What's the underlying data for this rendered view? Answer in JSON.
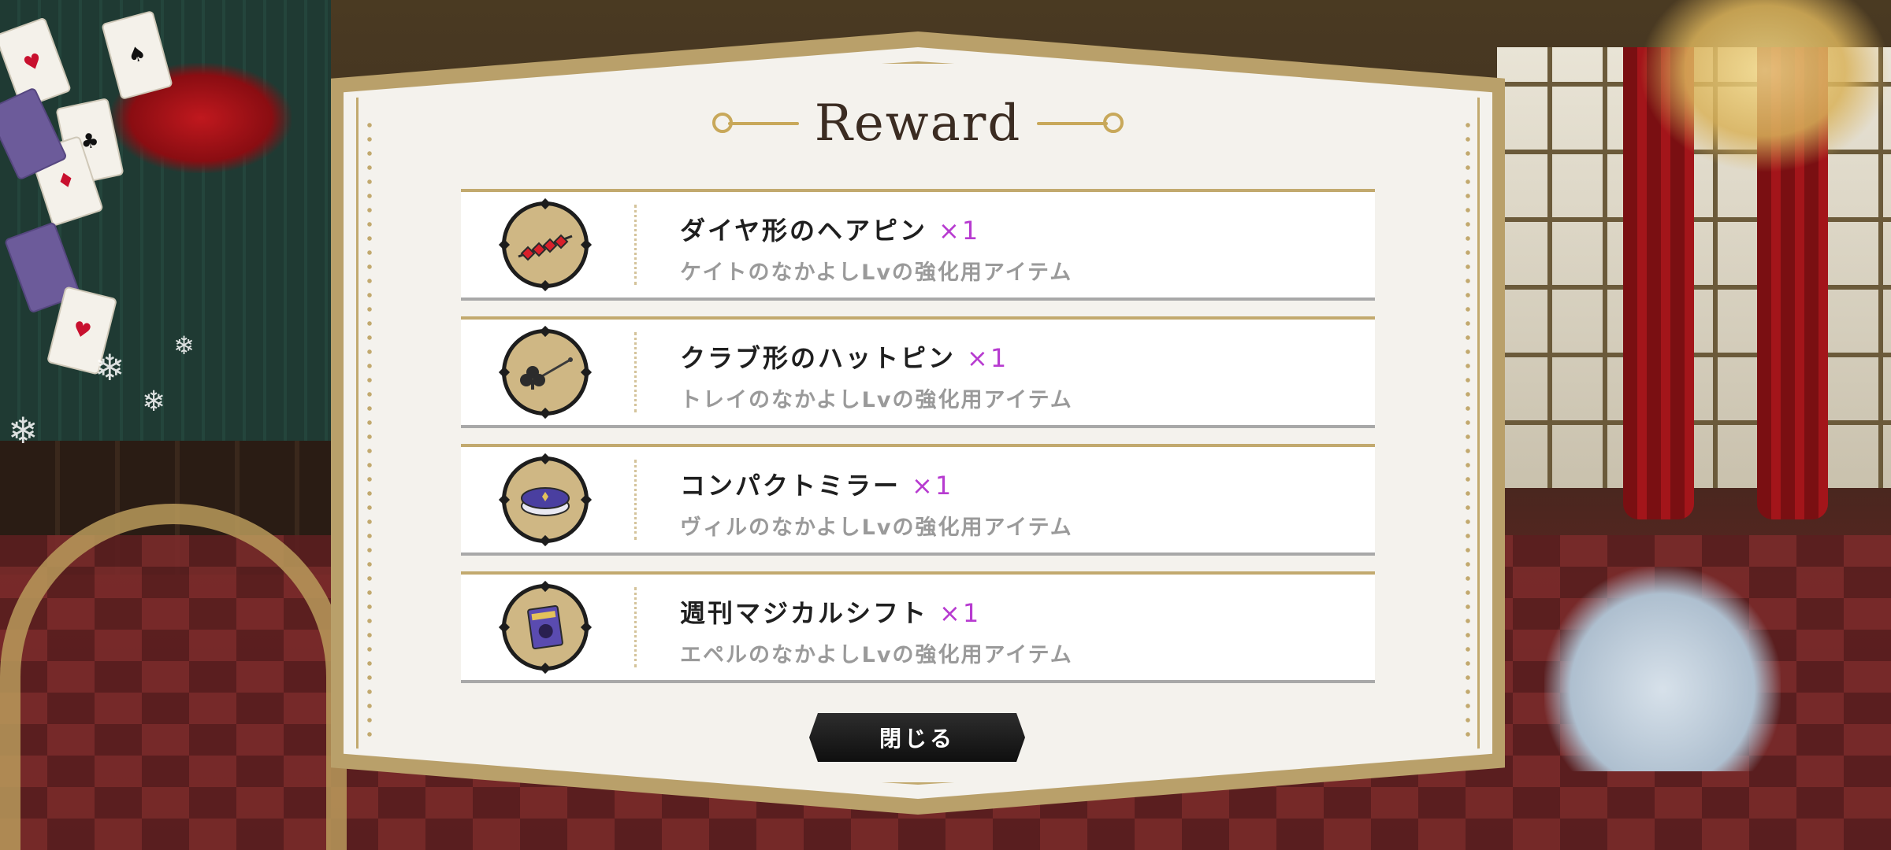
{
  "dialog": {
    "title": "Reward",
    "close_label": "閉じる"
  },
  "rewards": [
    {
      "name": "ダイヤ形のヘアピン",
      "quantity": "×1",
      "description": "ケイトのなかよしLvの強化用アイテム",
      "icon": "diamond-hairpin-icon"
    },
    {
      "name": "クラブ形のハットピン",
      "quantity": "×1",
      "description": "トレイのなかよしLvの強化用アイテム",
      "icon": "club-hatpin-icon"
    },
    {
      "name": "コンパクトミラー",
      "quantity": "×1",
      "description": "ヴィルのなかよしLvの強化用アイテム",
      "icon": "compact-mirror-icon"
    },
    {
      "name": "週刊マジカルシフト",
      "quantity": "×1",
      "description": "エペルのなかよしLvの強化用アイテム",
      "icon": "magazine-icon"
    }
  ],
  "colors": {
    "quantity": "#b73bd0",
    "frame_gold": "#c2a96e",
    "title": "#3b2c22"
  }
}
